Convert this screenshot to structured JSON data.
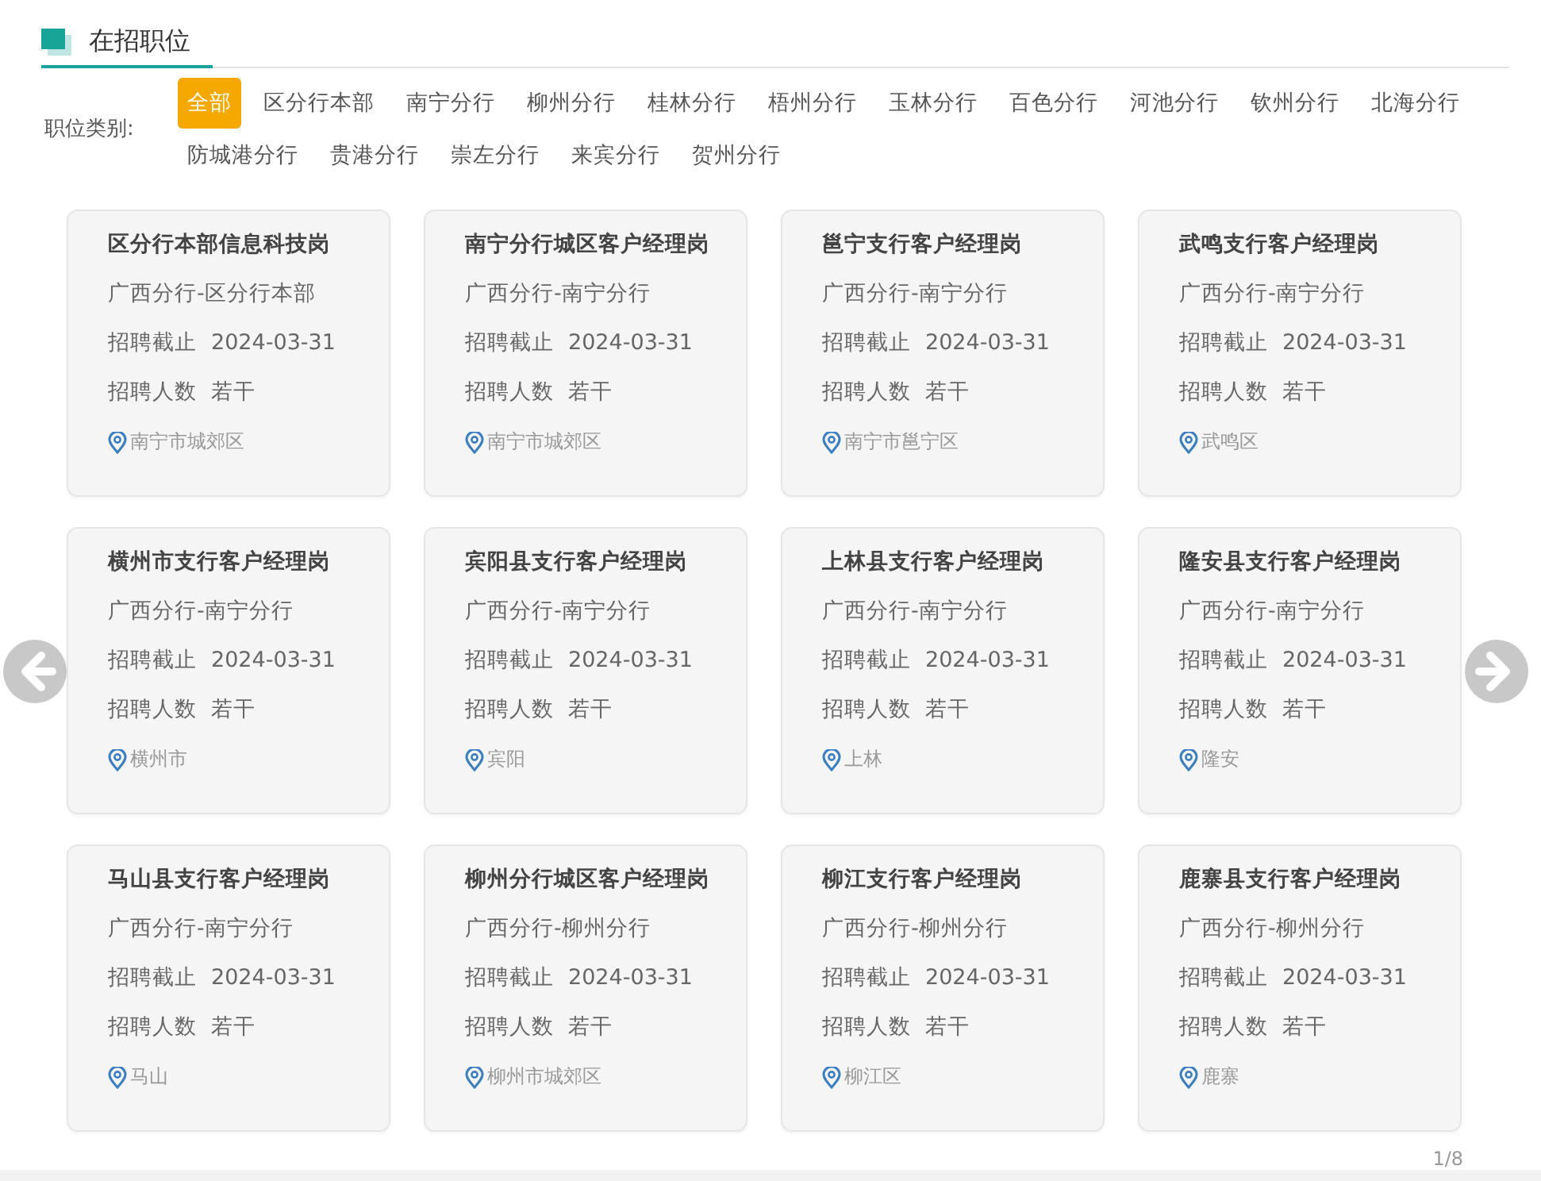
{
  "section": {
    "title": "在招职位"
  },
  "filter": {
    "label": "职位类别:",
    "categories": [
      {
        "label": "全部",
        "selected": true
      },
      {
        "label": "区分行本部",
        "selected": false
      },
      {
        "label": "南宁分行",
        "selected": false
      },
      {
        "label": "柳州分行",
        "selected": false
      },
      {
        "label": "桂林分行",
        "selected": false
      },
      {
        "label": "梧州分行",
        "selected": false
      },
      {
        "label": "玉林分行",
        "selected": false
      },
      {
        "label": "百色分行",
        "selected": false
      },
      {
        "label": "河池分行",
        "selected": false
      },
      {
        "label": "钦州分行",
        "selected": false
      },
      {
        "label": "北海分行",
        "selected": false
      },
      {
        "label": "防城港分行",
        "selected": false
      },
      {
        "label": "贵港分行",
        "selected": false
      },
      {
        "label": "崇左分行",
        "selected": false
      },
      {
        "label": "来宾分行",
        "selected": false
      },
      {
        "label": "贺州分行",
        "selected": false
      }
    ]
  },
  "jobs": [
    {
      "title": "区分行本部信息科技岗",
      "org": "广西分行-区分行本部",
      "deadline_label": "招聘截止",
      "deadline": "2024-03-31",
      "count_label": "招聘人数",
      "count": "若干",
      "location": "南宁市城郊区"
    },
    {
      "title": "南宁分行城区客户经理岗",
      "org": "广西分行-南宁分行",
      "deadline_label": "招聘截止",
      "deadline": "2024-03-31",
      "count_label": "招聘人数",
      "count": "若干",
      "location": "南宁市城郊区"
    },
    {
      "title": "邕宁支行客户经理岗",
      "org": "广西分行-南宁分行",
      "deadline_label": "招聘截止",
      "deadline": "2024-03-31",
      "count_label": "招聘人数",
      "count": "若干",
      "location": "南宁市邕宁区"
    },
    {
      "title": "武鸣支行客户经理岗",
      "org": "广西分行-南宁分行",
      "deadline_label": "招聘截止",
      "deadline": "2024-03-31",
      "count_label": "招聘人数",
      "count": "若干",
      "location": "武鸣区"
    },
    {
      "title": "横州市支行客户经理岗",
      "org": "广西分行-南宁分行",
      "deadline_label": "招聘截止",
      "deadline": "2024-03-31",
      "count_label": "招聘人数",
      "count": "若干",
      "location": "横州市"
    },
    {
      "title": "宾阳县支行客户经理岗",
      "org": "广西分行-南宁分行",
      "deadline_label": "招聘截止",
      "deadline": "2024-03-31",
      "count_label": "招聘人数",
      "count": "若干",
      "location": "宾阳"
    },
    {
      "title": "上林县支行客户经理岗",
      "org": "广西分行-南宁分行",
      "deadline_label": "招聘截止",
      "deadline": "2024-03-31",
      "count_label": "招聘人数",
      "count": "若干",
      "location": "上林"
    },
    {
      "title": "隆安县支行客户经理岗",
      "org": "广西分行-南宁分行",
      "deadline_label": "招聘截止",
      "deadline": "2024-03-31",
      "count_label": "招聘人数",
      "count": "若干",
      "location": "隆安"
    },
    {
      "title": "马山县支行客户经理岗",
      "org": "广西分行-南宁分行",
      "deadline_label": "招聘截止",
      "deadline": "2024-03-31",
      "count_label": "招聘人数",
      "count": "若干",
      "location": "马山"
    },
    {
      "title": "柳州分行城区客户经理岗",
      "org": "广西分行-柳州分行",
      "deadline_label": "招聘截止",
      "deadline": "2024-03-31",
      "count_label": "招聘人数",
      "count": "若干",
      "location": "柳州市城郊区"
    },
    {
      "title": "柳江支行客户经理岗",
      "org": "广西分行-柳州分行",
      "deadline_label": "招聘截止",
      "deadline": "2024-03-31",
      "count_label": "招聘人数",
      "count": "若干",
      "location": "柳江区"
    },
    {
      "title": "鹿寨县支行客户经理岗",
      "org": "广西分行-柳州分行",
      "deadline_label": "招聘截止",
      "deadline": "2024-03-31",
      "count_label": "招聘人数",
      "count": "若干",
      "location": "鹿寨"
    }
  ],
  "pager": {
    "page": "1/8"
  }
}
